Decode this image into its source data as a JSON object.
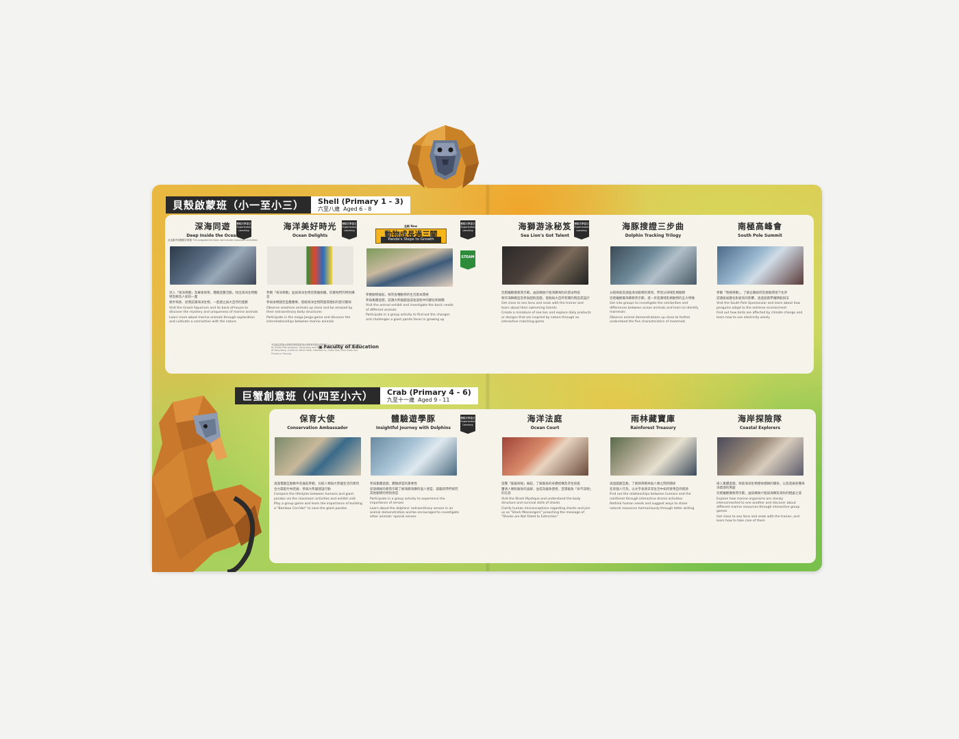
{
  "section1": {
    "title_cn": "貝殼啟蒙班（小一至小三）",
    "title_en": "Shell (Primary 1 - 3)",
    "age_cn": "六至八歲",
    "age_en": "Aged 6 - 8"
  },
  "section2": {
    "title_cn": "巨蟹創意班（小四至小六）",
    "title_en": "Crab (Primary 4 - 6)",
    "age_cn": "九至十一歲",
    "age_en": "Aged 9 - 11"
  },
  "badge_label": "體驗式學習法 Experiential Learning",
  "new_label": "全新 New",
  "steam_label": "STEAM",
  "courses1": [
    {
      "cn": "深海同遊",
      "en": "Deep Inside the Ocean",
      "note": "此活動不設體驗式學習 This programme does not include classroom activities",
      "bullets": [
        "深入「海洋奇觀」及幕後地帶，體驗遊覽活動，找出海洋生物獨特及鮮為人知的一面",
        "親手探索、從而認識海洋生物，一起建立與大自然的連繫",
        "Visit the Grand Aquarium and its back-of-house to discover the mystery and uniqueness of marine animals",
        "Learn more about marine animals through exploration and cultivate a connection with the nature"
      ]
    },
    {
      "cn": "海洋美好時光",
      "en": "Ocean Delights",
      "bullets": [
        "參觀「海洋奇觀」並與海洋生物近距離接觸，欣賞牠們的特別構造",
        "參與食物鏈巨型疊疊樂，發掘海洋生物間連環相扣的密切關係",
        "Observe seashore animals up close and be amazed by their extraordinary body structures",
        "Participate in the mega Jenga game and discover the interrelationships between marine animals"
      ]
    },
    {
      "cn": "動物成長過三關",
      "en": "Panda's Steps to Growth",
      "bullets": [
        "參觀動物展館，探究各種動物的生活基本需要",
        "參與集體遊戲，認識大熊貓越過成長過程中的變化和挑戰",
        "Visit the animal exhibit and investigate the basic needs of different animals",
        "Participate in a group activity to find out the changes and challenges a giant panda faces in growing up"
      ]
    },
    {
      "cn": "海獅游泳秘笈",
      "en": "Sea Lion's Got Talent",
      "bullets": [
        "近距離觀賞教育示範，由訓練員介紹海獅海豹的游泳特技",
        "製作海獅模型及參與配對遊戲，發掘與大自然有關的用品或設計",
        "Get close to sea lions and seals with the trainer and learn about their swimming talents",
        "Create a miniature of sea lion and explore daily products or designs that are inspired by nature through an interactive matching game"
      ]
    },
    {
      "cn": "海豚搜證三步曲",
      "en": "Dolphin Tracking Trilogy",
      "bullets": [
        "分組探索及調查海洋動物的異同，學習分辨哺乳類動物",
        "近距離觀賞海豚教育示範，進一步認識哺乳類動物的五大特徵",
        "Get into groups to investigate the similarities and differences between ocean animals and learn to identify mammals",
        "Observe animal demonstrations up close to further understand the five characteristics of mammals"
      ]
    },
    {
      "cn": "南極高峰會",
      "en": "South Pole Summit",
      "bullets": [
        "參觀「南極奇觀」，了解企鵝如何在極端環境下生存",
        "認識氣候變化對雀鳥的影響，透過遊戲學懂節能辦法",
        "Visit the South Pole Spectacular and learn about how penguins adapt to the extreme environment",
        "Find out how birds are affected by climate change and learn how to use electricity wisely"
      ]
    }
  ],
  "courses2": [
    {
      "cn": "保育大使",
      "en": "Conservation Ambassador",
      "bullets": [
        "透過電腦互動軟件及展館參觀，比較人類與大熊貓生活的異同",
        "合力築起竹林走廊，參與大熊貓建設行動",
        "Compare the lifestyles between humans and giant pandas via the classroom activities and exhibit visit",
        "Play a group game and learn the importance of building a \"Bamboo Corridor\" to save the giant pandas"
      ]
    },
    {
      "cn": "體驗遊學豚",
      "en": "Insightful Journey with Dolphins",
      "bullets": [
        "參與集體遊戲，體驗感官的重要性",
        "從訓練員的教育示範了解海豚海獅的過人感官，鼓勵同學們探究其他動物的特別感官",
        "Participate in a group activity to experience the importance of senses",
        "Learn about the dolphins' extraordinary senses in an animal demonstration and be encouraged to investigate other animals' special senses"
      ]
    },
    {
      "cn": "海洋法庭",
      "en": "Ocean Court",
      "bullets": [
        "遊覽「鯊鯊探秘」展館，了解鯊魚的身體結構及求生技能",
        "釐清人類對鯊魚的誤解，並成為鯊魚使者，宣揚鯊魚「命不該絕」的信息",
        "Visit the Shark Mystique and understand the body structure and survival skills of sharks",
        "Clarify human misconceptions regarding sharks and join us as \"Shark Messengers\" preaching the message of \"Sharks are Not Fated to Extinction\""
      ]
    },
    {
      "cn": "雨林藏寶庫",
      "en": "Rainforest Treasury",
      "bullets": [
        "透過戲劇互動，了解熱帶雨林與人類之間的關係",
        "反思個人行為，以文字表達日常生活中如何善用自然資源",
        "Find out the relationships between humans and the rainforest through interactive drama activities",
        "Rethink human needs and suggest ways to share natural resources harmoniously through letter writing"
      ]
    },
    {
      "cn": "海岸探險隊",
      "en": "Coastal Explorers",
      "bullets": [
        "投入集體遊戲，探索海洋生物相依相賴的關係，以及發展各種海洋資源的用處",
        "近距離觀賞教育示範，由訓練員介紹與海獅及海豹的相處之道",
        "Explore how marine organisms are closely interconnected to one another and discover about different marine resources through interactive group games",
        "Get close to sea lions and seals with the trainer, and learn how to take care of them"
      ]
    }
  ],
  "credit": "本活動由香港大學教育學院與香港大學教育學院合作研發 This programme was developed by Ocean Park Academy, Hong Kong and the Faculty of Education, The University of Hong Kong. (Credit to: Kelvin Shek, Gabriella Au, Cathy Kam, Alice Kwan and Prudence Cheung)",
  "logo_text": "Faculty of Education",
  "colors": {
    "header": "#2a2a2a",
    "banner": "#f7b51c",
    "panel": "#f6f3ea",
    "steam": "#2e8b3a"
  }
}
